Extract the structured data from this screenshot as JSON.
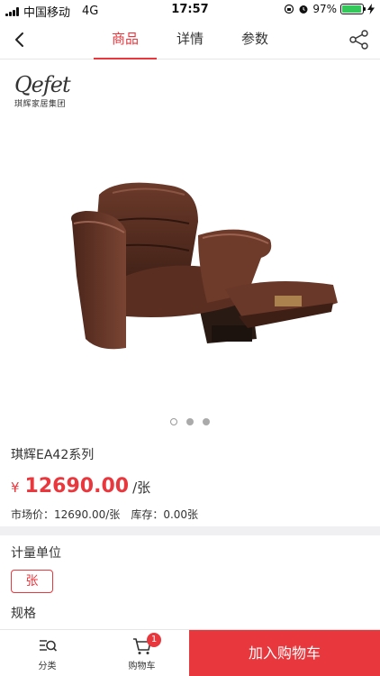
{
  "status_bar": {
    "carrier": "中国移动",
    "network": "4G",
    "time": "17:57",
    "battery_percent": "97%",
    "battery_level": 0.97
  },
  "nav": {
    "tabs": [
      {
        "label": "商品",
        "active": true
      },
      {
        "label": "详情",
        "active": false
      },
      {
        "label": "参数",
        "active": false
      }
    ]
  },
  "gallery": {
    "brand_name": "Qefet",
    "brand_sub": "琪辉家居集团",
    "image_count": 3,
    "current_index": 0
  },
  "product": {
    "name": "琪辉EA42系列",
    "currency": "¥",
    "price": "12690.00",
    "unit": "/张",
    "market_price": "市场价：12690.00/张",
    "stock": "库存：0.00张"
  },
  "options": {
    "unit_label": "计量单位",
    "unit_value": "张",
    "spec_label": "规格"
  },
  "bottom_bar": {
    "category_label": "分类",
    "cart_label": "购物车",
    "cart_count": "1",
    "add_to_cart_label": "加入购物车"
  },
  "colors": {
    "accent": "#e8373d",
    "divider": "#f0f0f2"
  }
}
